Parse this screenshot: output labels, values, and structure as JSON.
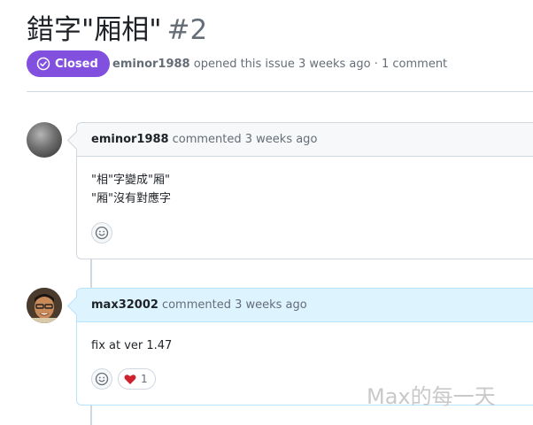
{
  "issue": {
    "title": "錯字\"厢相\"",
    "number": "#2",
    "state": "Closed",
    "author": "eminor1988",
    "meta_text": "opened this issue 3 weeks ago · 1 comment"
  },
  "comments": [
    {
      "author": "eminor1988",
      "action": "commented 3 weeks ago",
      "body": [
        "\"相\"字變成\"厢\"",
        "\"厢\"沒有對應字"
      ]
    },
    {
      "author": "max32002",
      "action": "commented 3 weeks ago",
      "body": [
        "fix at ver 1.47"
      ],
      "reaction": {
        "icon": "heart-icon",
        "count": "1"
      }
    }
  ],
  "watermark": "Max的每一天",
  "colors": {
    "closed": "#8250df",
    "owner_header": "#ddf4ff",
    "heart": "#cf222e"
  }
}
